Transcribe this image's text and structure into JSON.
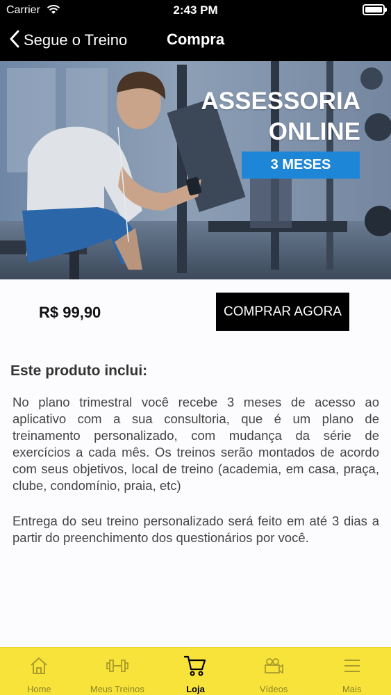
{
  "status_bar": {
    "carrier": "Carrier",
    "time": "2:43 PM"
  },
  "nav": {
    "back_label": "Segue o Treino",
    "title": "Compra"
  },
  "hero": {
    "title_line1": "ASSESSORIA",
    "title_line2": "ONLINE",
    "badge": "3 MESES",
    "badge_color": "#1e86d6"
  },
  "purchase": {
    "price": "R$ 99,90",
    "button_label": "COMPRAR AGORA"
  },
  "description": {
    "heading": "Este produto inclui:",
    "paragraph1": "No plano trimestral você recebe 3 meses de acesso ao aplicativo com a sua consultoria, que é um plano de treinamento personalizado, com mudança da série de exercícios a cada mês. Os treinos serão montados de acordo com seus objetivos, local de treino (academia, em casa, praça, clube, condomínio, praia, etc)",
    "paragraph2": "Entrega do seu treino personalizado será feito em até 3 dias a partir do preenchimento dos questionários por você."
  },
  "tab_bar": {
    "background": "#f8e33b",
    "items": [
      {
        "label": "Home",
        "icon": "home-icon",
        "active": false
      },
      {
        "label": "Meus Treinos",
        "icon": "dumbbell-icon",
        "active": false
      },
      {
        "label": "Loja",
        "icon": "cart-icon",
        "active": true
      },
      {
        "label": "Vídeos",
        "icon": "video-camera-icon",
        "active": false
      },
      {
        "label": "Mais",
        "icon": "menu-icon",
        "active": false
      }
    ]
  }
}
